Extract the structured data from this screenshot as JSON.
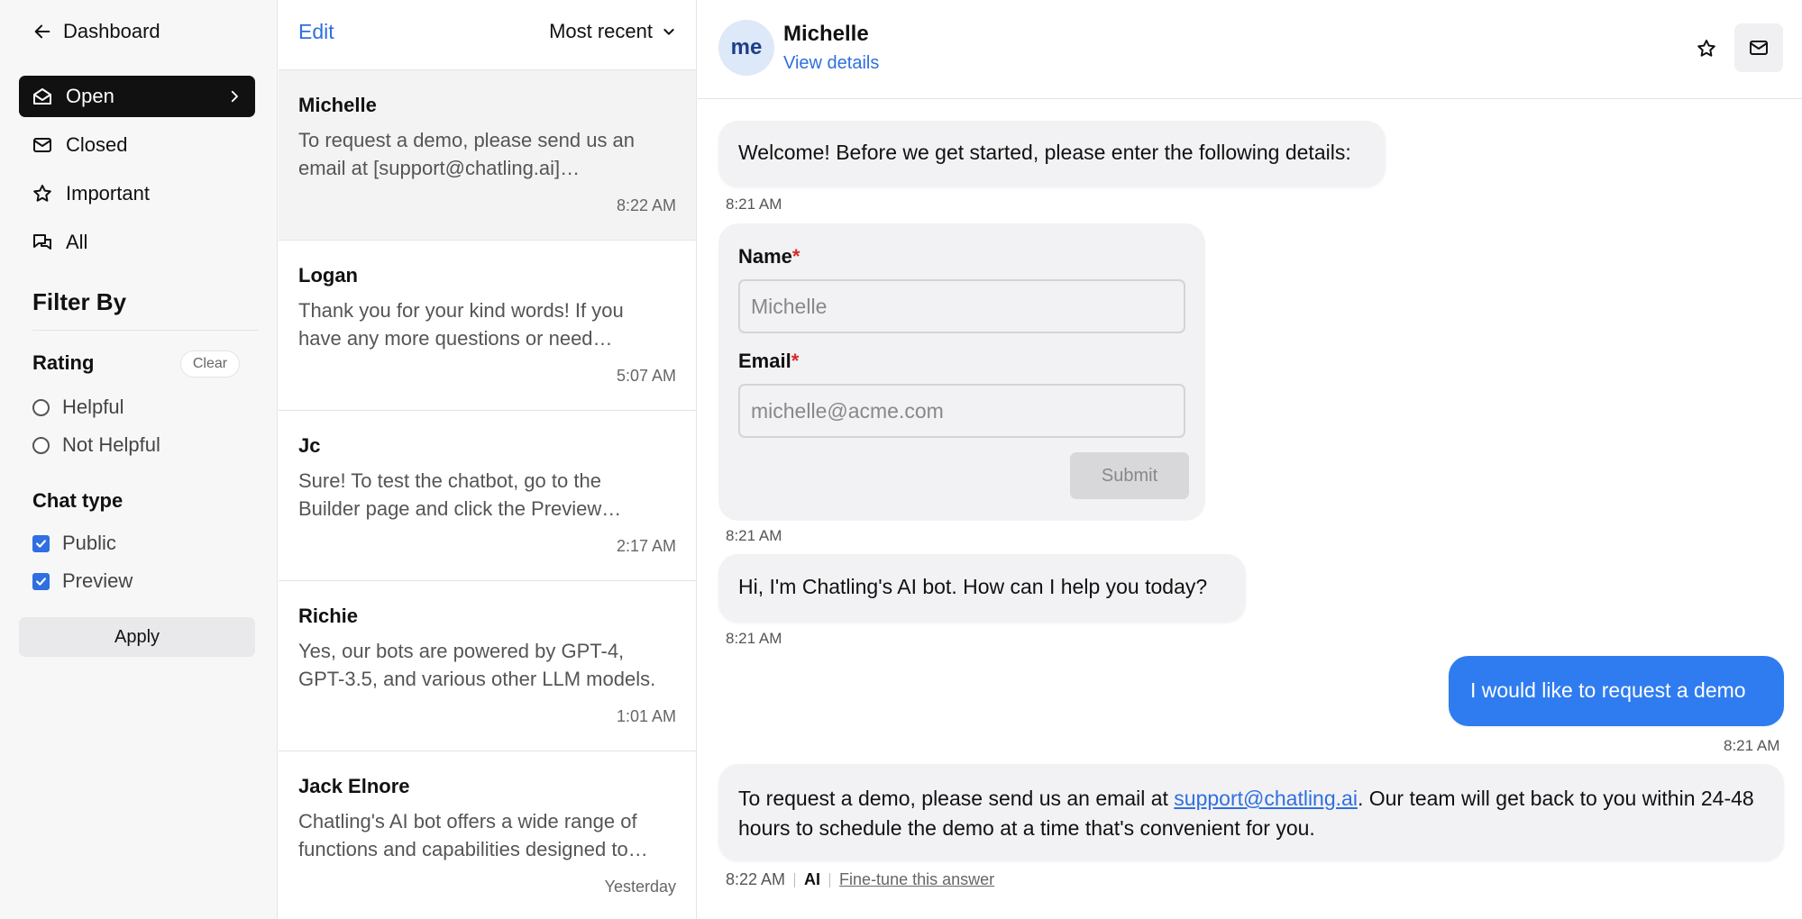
{
  "sidebar": {
    "back_label": "Dashboard",
    "nav": [
      {
        "label": "Open",
        "icon": "envelope-open-icon",
        "active": true
      },
      {
        "label": "Closed",
        "icon": "mail-icon",
        "active": false
      },
      {
        "label": "Important",
        "icon": "star-icon",
        "active": false
      },
      {
        "label": "All",
        "icon": "chats-icon",
        "active": false
      }
    ],
    "filter_title": "Filter By",
    "rating": {
      "title": "Rating",
      "clear_label": "Clear",
      "options": [
        "Helpful",
        "Not Helpful"
      ]
    },
    "chat_type": {
      "title": "Chat type",
      "options": [
        {
          "label": "Public",
          "checked": true
        },
        {
          "label": "Preview",
          "checked": true
        }
      ]
    },
    "apply_label": "Apply"
  },
  "list": {
    "edit_label": "Edit",
    "sort_label": "Most recent",
    "conversations": [
      {
        "name": "Michelle",
        "preview": "To request a demo, please send us an email at [support@chatling.ai]…",
        "time": "8:22 AM",
        "selected": true
      },
      {
        "name": "Logan",
        "preview": "Thank you for your kind words! If you have any more questions or need…",
        "time": "5:07 AM",
        "selected": false
      },
      {
        "name": "Jc",
        "preview": "Sure! To test the chatbot, go to the Builder page and click the Preview…",
        "time": "2:17 AM",
        "selected": false
      },
      {
        "name": "Richie",
        "preview": "Yes, our bots are powered by GPT-4, GPT-3.5, and various other LLM models.",
        "time": "1:01 AM",
        "selected": false
      },
      {
        "name": "Jack Elnore",
        "preview": "Chatling's AI bot offers a wide range of functions and capabilities designed to…",
        "time": "Yesterday",
        "selected": false
      }
    ]
  },
  "chat": {
    "avatar_text": "me",
    "name": "Michelle",
    "view_details": "View details",
    "messages": {
      "welcome": "Welcome! Before we get started, please enter the following details:",
      "welcome_time": "8:21 AM",
      "form": {
        "name_label": "Name",
        "name_value": "Michelle",
        "email_label": "Email",
        "email_value": "michelle@acme.com",
        "required_mark": "*",
        "submit_label": "Submit"
      },
      "form_time": "8:21 AM",
      "greeting": "Hi, I'm Chatling's AI bot. How can I help you today?",
      "greeting_time": "8:21 AM",
      "user_msg": "I would like to request a demo",
      "user_time": "8:21 AM",
      "reply_part1": "To request a demo, please send us an email at ",
      "reply_link": "support@chatling.ai",
      "reply_part2": ". Our team will get back to you within 24-48 hours to schedule the demo at a time that's convenient for you.",
      "reply_time": "8:22 AM",
      "reply_badge": "AI",
      "fine_tune": "Fine-tune this answer"
    }
  },
  "colors": {
    "accent": "#2f6fe0",
    "user_bubble": "#2f7cf0",
    "required": "#d62b2b"
  }
}
